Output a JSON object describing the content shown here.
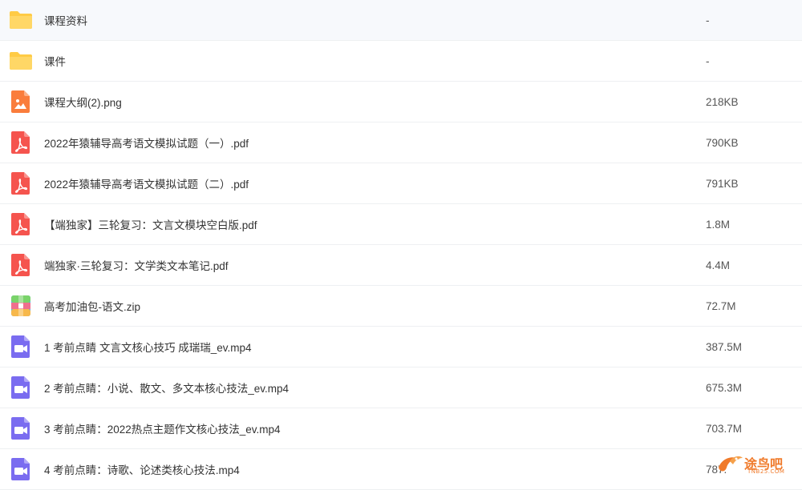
{
  "files": [
    {
      "name": "课程资料",
      "size": "-",
      "type": "folder"
    },
    {
      "name": "课件",
      "size": "-",
      "type": "folder"
    },
    {
      "name": "课程大纲(2).png",
      "size": "218KB",
      "type": "image"
    },
    {
      "name": "2022年猿辅导高考语文模拟试题（一）.pdf",
      "size": "790KB",
      "type": "pdf"
    },
    {
      "name": "2022年猿辅导高考语文模拟试题（二）.pdf",
      "size": "791KB",
      "type": "pdf"
    },
    {
      "name": "【端独家】三轮复习：文言文模块空白版.pdf",
      "size": "1.8M",
      "type": "pdf"
    },
    {
      "name": "端独家·三轮复习：文学类文本笔记.pdf",
      "size": "4.4M",
      "type": "pdf"
    },
    {
      "name": "高考加油包-语文.zip",
      "size": "72.7M",
      "type": "zip"
    },
    {
      "name": "1 考前点睛 文言文核心技巧 成瑞瑞_ev.mp4",
      "size": "387.5M",
      "type": "video"
    },
    {
      "name": "2 考前点睛：小说、散文、多文本核心技法_ev.mp4",
      "size": "675.3M",
      "type": "video"
    },
    {
      "name": "3 考前点睛：2022热点主题作文核心技法_ev.mp4",
      "size": "703.7M",
      "type": "video"
    },
    {
      "name": "4 考前点睛：诗歌、论述类核心技法.mp4",
      "size": "787.",
      "type": "video"
    }
  ],
  "icons": {
    "folder": "folder-icon",
    "image": "image-file-icon",
    "pdf": "pdf-file-icon",
    "zip": "zip-file-icon",
    "video": "video-file-icon"
  },
  "colors": {
    "folder": "#ffcb45",
    "image": "#fa7d3c",
    "pdf": "#f5544e",
    "video": "#7a6cf0",
    "watermark": "#f07a2a"
  },
  "watermark": {
    "text": "途鸟吧",
    "sub": "TNB25.COM"
  }
}
